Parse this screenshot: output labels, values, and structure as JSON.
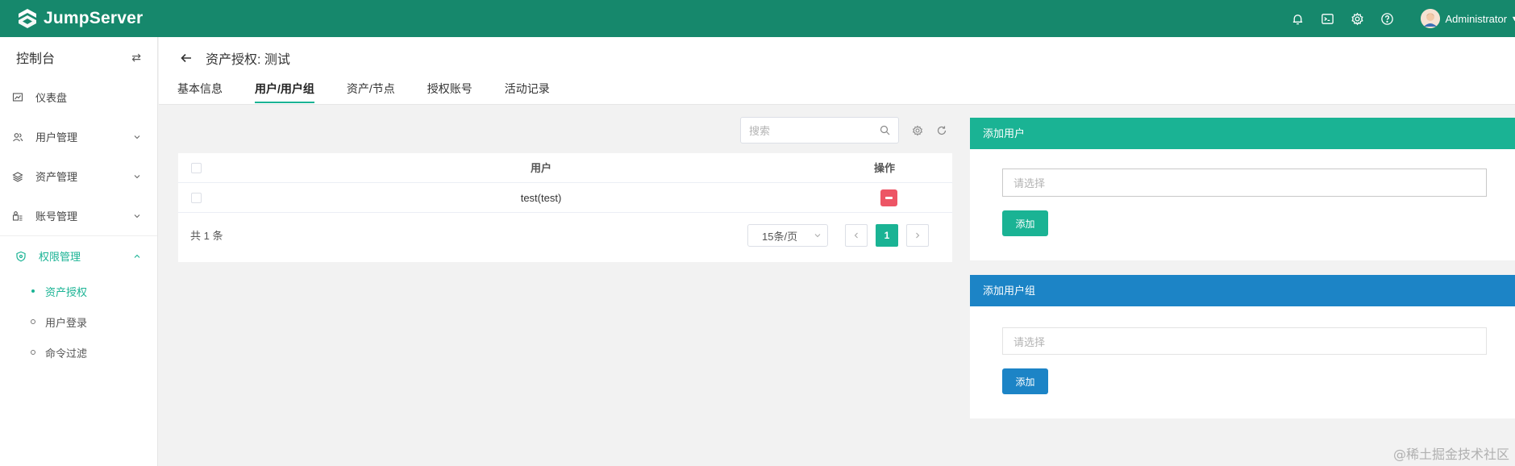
{
  "app": {
    "name": "JumpServer"
  },
  "header": {
    "user_name": "Administrator"
  },
  "sidebar": {
    "title": "控制台",
    "items": [
      {
        "label": "仪表盘"
      },
      {
        "label": "用户管理"
      },
      {
        "label": "资产管理"
      },
      {
        "label": "账号管理"
      },
      {
        "label": "权限管理"
      }
    ],
    "sub_items": [
      {
        "label": "资产授权",
        "active": true
      },
      {
        "label": "用户登录",
        "active": false
      },
      {
        "label": "命令过滤",
        "active": false
      }
    ]
  },
  "page": {
    "title": "资产授权: 测试",
    "tabs": [
      {
        "label": "基本信息",
        "active": false
      },
      {
        "label": "用户/用户组",
        "active": true
      },
      {
        "label": "资产/节点",
        "active": false
      },
      {
        "label": "授权账号",
        "active": false
      },
      {
        "label": "活动记录",
        "active": false
      }
    ]
  },
  "table": {
    "search_placeholder": "搜索",
    "columns": {
      "user": "用户",
      "action": "操作"
    },
    "rows": [
      {
        "user": "test(test)"
      }
    ],
    "total": "共 1 条",
    "page_size": "15条/页",
    "current_page": "1"
  },
  "add_user": {
    "title": "添加用户",
    "placeholder": "请选择",
    "button": "添加"
  },
  "add_group": {
    "title": "添加用户组",
    "placeholder": "请选择",
    "button": "添加"
  },
  "watermark": "@稀土掘金技术社区",
  "colors": {
    "topbar": "#16886c",
    "accent": "#1ab394",
    "blue": "#1c84c6",
    "danger": "#ed5565"
  }
}
